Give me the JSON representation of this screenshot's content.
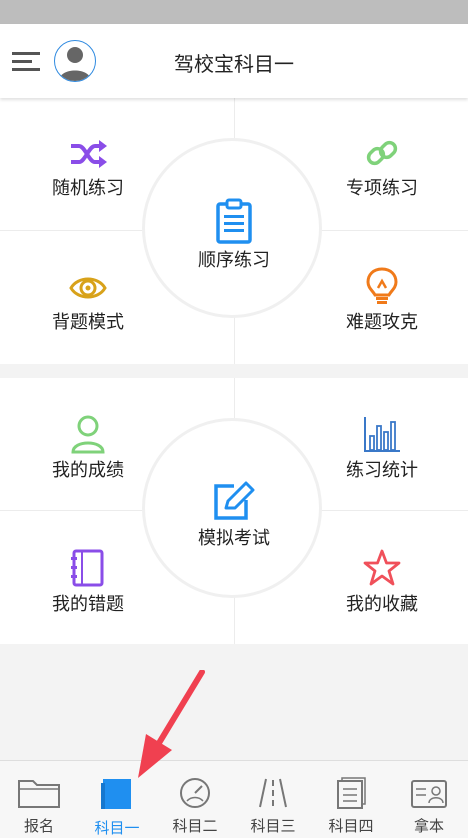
{
  "header": {
    "title": "驾校宝科目一"
  },
  "practice_panel": {
    "center_label": "顺序练习",
    "items": [
      {
        "label": "随机练习"
      },
      {
        "label": "专项练习"
      },
      {
        "label": "背题模式"
      },
      {
        "label": "难题攻克"
      }
    ]
  },
  "exam_panel": {
    "center_label": "模拟考试",
    "items": [
      {
        "label": "我的成绩"
      },
      {
        "label": "练习统计"
      },
      {
        "label": "我的错题"
      },
      {
        "label": "我的收藏"
      }
    ]
  },
  "tabs": [
    {
      "label": "报名"
    },
    {
      "label": "科目一",
      "active": true
    },
    {
      "label": "科目二"
    },
    {
      "label": "科目三"
    },
    {
      "label": "科目四"
    },
    {
      "label": "拿本"
    }
  ],
  "colors": {
    "accent_blue": "#1f8ff0",
    "random_purple": "#8a4de8",
    "special_green": "#7fd27a",
    "eye_gold": "#d8a21a",
    "bulb_orange": "#f07a1a",
    "score_green": "#7fd27a",
    "stats_blue": "#3a78c8",
    "wrong_purple": "#8a4de8",
    "star_red": "#f0505a",
    "annotation_red": "#f04050"
  }
}
